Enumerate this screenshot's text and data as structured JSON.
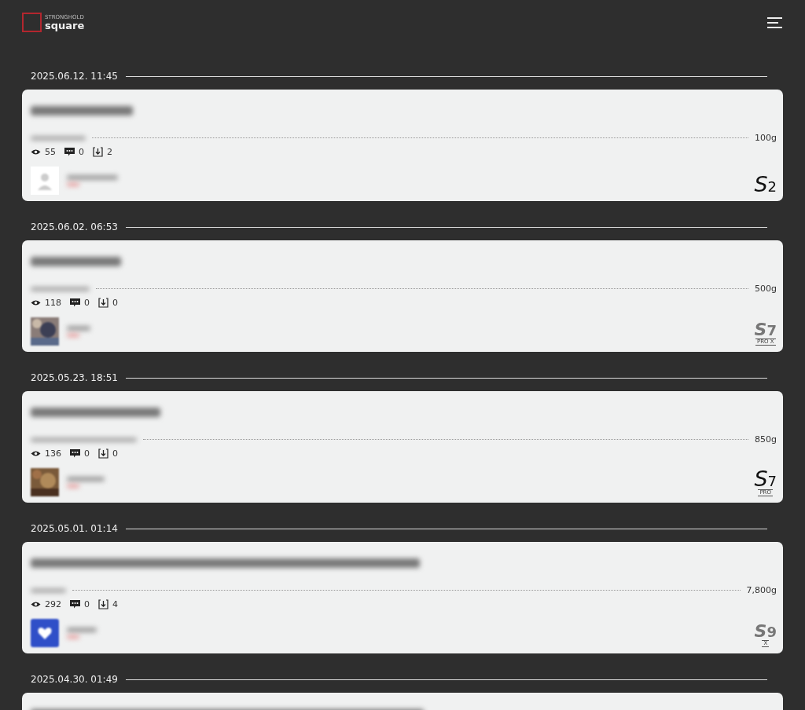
{
  "header": {
    "logo_top": "STRONGHOLD",
    "logo_main": "square"
  },
  "posts": [
    {
      "date": "2025.06.12. 11:45",
      "weight": "100g",
      "views": "55",
      "comments": "0",
      "downloads": "2",
      "avatar": {
        "kind": "silhouette"
      },
      "badge": {
        "kind": "thin",
        "main": "S",
        "sub": "2"
      }
    },
    {
      "date": "2025.06.02. 06:53",
      "weight": "500g",
      "views": "118",
      "comments": "0",
      "downloads": "0",
      "badge": {
        "kind": "bold",
        "main": "S",
        "sub": "7",
        "edition": "PRO X"
      }
    },
    {
      "date": "2025.05.23. 18:51",
      "weight": "850g",
      "views": "136",
      "comments": "0",
      "downloads": "0",
      "badge": {
        "kind": "thin",
        "main": "S",
        "sub": "7",
        "edition": "PRO"
      }
    },
    {
      "date": "2025.05.01. 01:14",
      "weight": "7,800g",
      "views": "292",
      "comments": "0",
      "downloads": "4",
      "avatar": {
        "kind": "icon"
      },
      "badge": {
        "kind": "bold",
        "main": "S",
        "sub": "9",
        "edition": "X"
      }
    },
    {
      "date": "2025.04.30. 01:49"
    }
  ]
}
